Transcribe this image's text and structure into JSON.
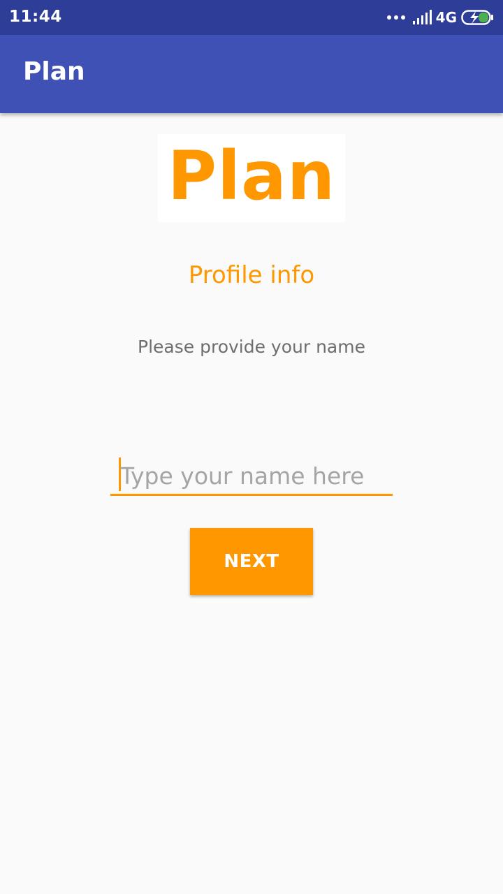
{
  "status_bar": {
    "time": "11:44",
    "network": "4G",
    "icons": [
      "more-dots-icon",
      "signal-icon",
      "battery-charging-icon"
    ]
  },
  "app_bar": {
    "title": "Plan",
    "color": "#3f51b5",
    "status_color": "#2e3d98"
  },
  "logo": {
    "text": "Plan",
    "color": "#ff9800"
  },
  "profile": {
    "title": "Profile info",
    "description": "Please provide your name"
  },
  "name_input": {
    "placeholder": "Type your name here",
    "value": ""
  },
  "next_button": {
    "label": "NEXT"
  },
  "accent_color": "#ff9800"
}
